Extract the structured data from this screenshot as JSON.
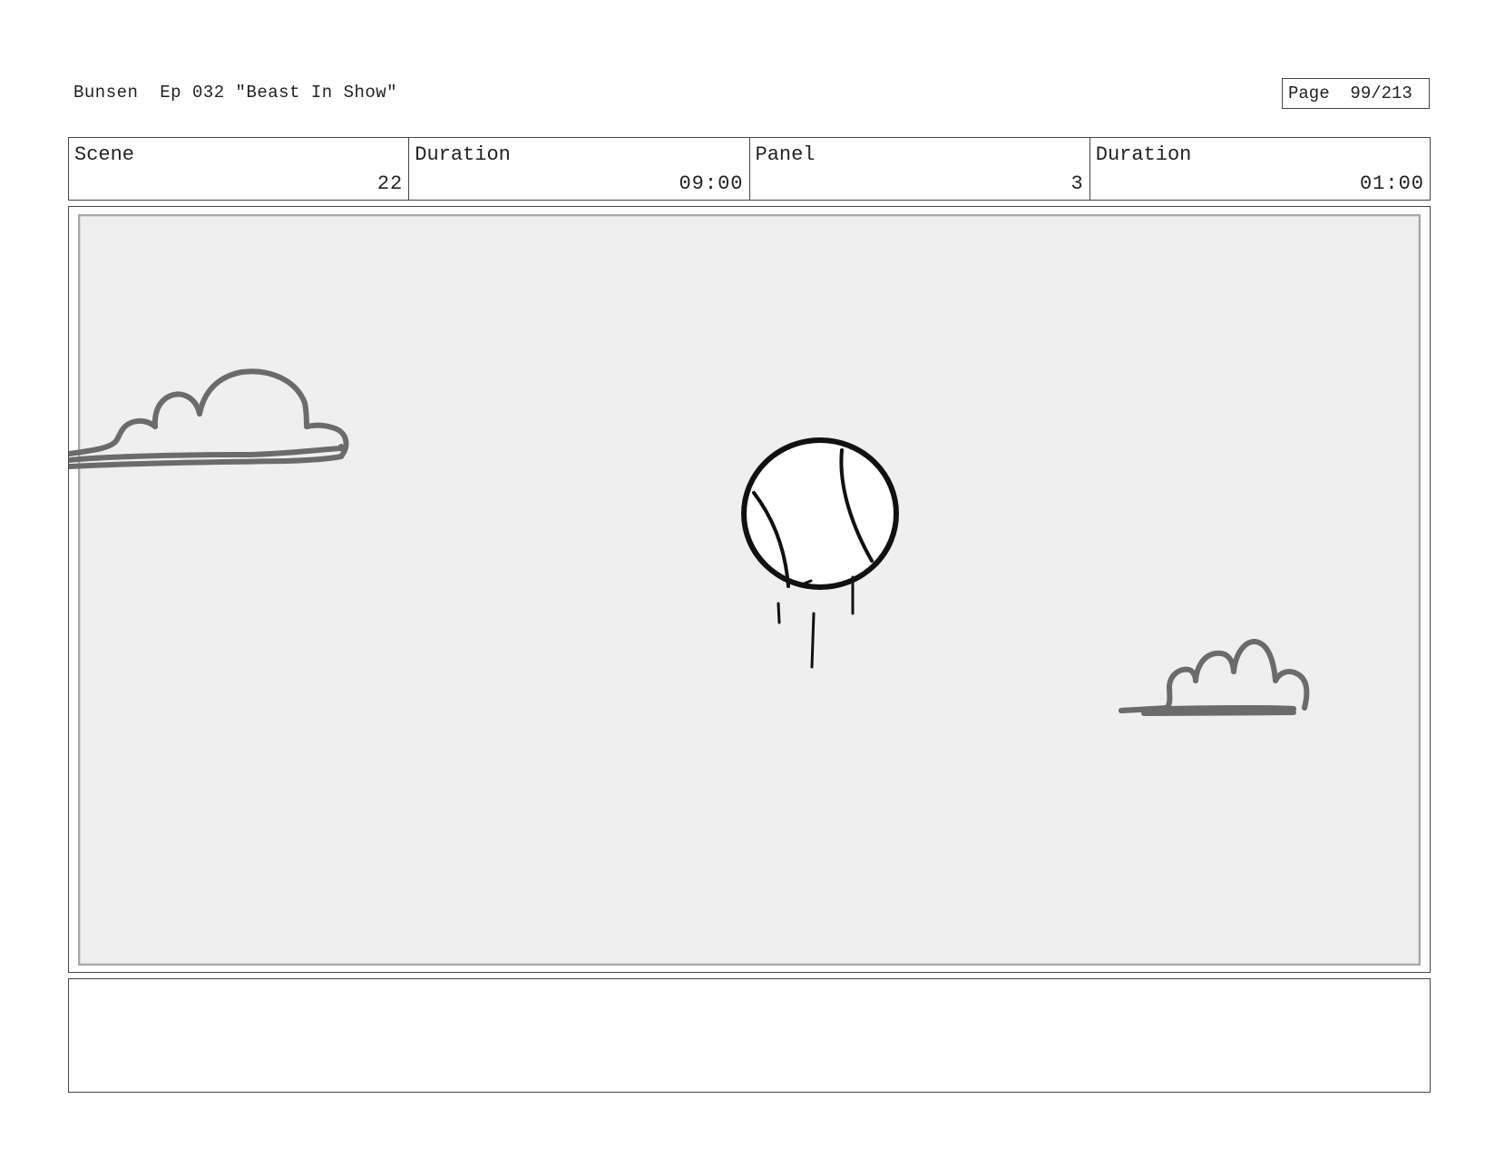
{
  "header": {
    "show": "Bunsen",
    "episode": "Ep 032 \"Beast In Show\"",
    "page_label": "Page",
    "page_value": "99/213"
  },
  "info": {
    "scene_label": "Scene",
    "scene_value": "22",
    "scene_duration_label": "Duration",
    "scene_duration_value": "09:00",
    "panel_label": "Panel",
    "panel_value": "3",
    "panel_duration_label": "Duration",
    "panel_duration_value": "01:00"
  },
  "panel_art": {
    "background": "#efefef",
    "cloud_color": "#6b6b6b",
    "ink_color": "#111111",
    "objects": [
      "cloud-left",
      "baseball",
      "cloud-right"
    ]
  },
  "notes": {
    "text": ""
  }
}
